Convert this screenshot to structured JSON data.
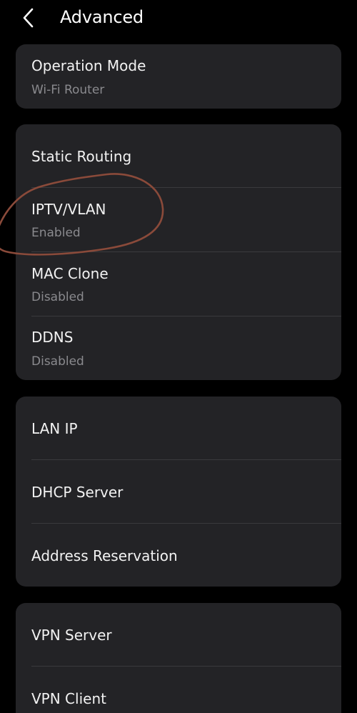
{
  "header": {
    "title": "Advanced",
    "back_icon": "chevron-left-icon"
  },
  "cards": [
    {
      "items": [
        {
          "label": "Operation Mode",
          "value": "Wi-Fi Router"
        }
      ]
    },
    {
      "items": [
        {
          "label": "Static Routing"
        },
        {
          "label": "IPTV/VLAN",
          "value": "Enabled"
        },
        {
          "label": "MAC Clone",
          "value": "Disabled"
        },
        {
          "label": "DDNS",
          "value": "Disabled"
        }
      ]
    },
    {
      "items": [
        {
          "label": "LAN IP"
        },
        {
          "label": "DHCP Server"
        },
        {
          "label": "Address Reservation"
        }
      ]
    },
    {
      "items": [
        {
          "label": "VPN Server"
        },
        {
          "label": "VPN Client"
        }
      ]
    }
  ],
  "colors": {
    "background": "#000000",
    "card": "#232326",
    "primary_text": "#f2f2f2",
    "secondary_text": "#8a8a8e",
    "divider": "#3a3a3d",
    "annotation_stroke": "#8a4a3a"
  }
}
